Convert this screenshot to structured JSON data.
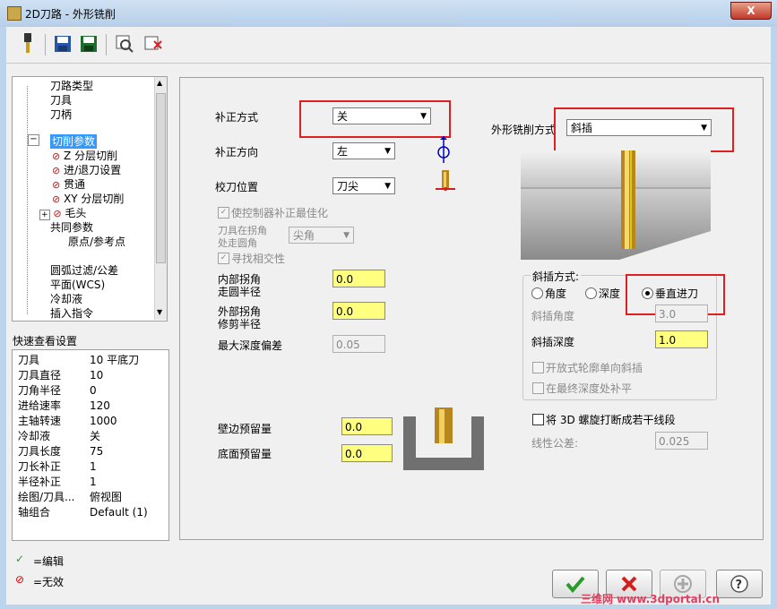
{
  "window": {
    "title": "2D刀路 - 外形铣削",
    "close_label": "X"
  },
  "toolbar": {
    "icons": [
      "tool-icon",
      "save-icon",
      "save-all-icon",
      "preview-icon",
      "delete-icon"
    ]
  },
  "tree": {
    "items": [
      {
        "label": "刀路类型"
      },
      {
        "label": "刀具"
      },
      {
        "label": "刀柄"
      },
      {
        "label": "切削参数"
      },
      {
        "label": "Z 分层切削"
      },
      {
        "label": "进/退刀设置"
      },
      {
        "label": "贯通"
      },
      {
        "label": "XY 分层切削"
      },
      {
        "label": "毛头"
      },
      {
        "label": "共同参数"
      },
      {
        "label": "原点/参考点"
      },
      {
        "label": "圆弧过滤/公差"
      },
      {
        "label": "平面(WCS)"
      },
      {
        "label": "冷却液"
      },
      {
        "label": "插入指令"
      }
    ]
  },
  "quickview": {
    "title": "快速查看设置",
    "rows": [
      {
        "key": "刀具",
        "value": "10 平底刀"
      },
      {
        "key": "刀具直径",
        "value": "10"
      },
      {
        "key": "刀角半径",
        "value": "0"
      },
      {
        "key": "进给速率",
        "value": "120"
      },
      {
        "key": "主轴转速",
        "value": "1000"
      },
      {
        "key": "冷却液",
        "value": "关"
      },
      {
        "key": "刀具长度",
        "value": "75"
      },
      {
        "key": "刀长补正",
        "value": "1"
      },
      {
        "key": "半径补正",
        "value": "1"
      },
      {
        "key": "绘图/刀具...",
        "value": "俯视图"
      },
      {
        "key": "轴组合",
        "value": "Default (1)"
      }
    ]
  },
  "legend": {
    "edit": "=编辑",
    "invalid": "=无效"
  },
  "params": {
    "comp_type_label": "补正方式",
    "comp_type_value": "关",
    "comp_dir_label": "补正方向",
    "comp_dir_value": "左",
    "tip_label": "校刀位置",
    "tip_value": "刀尖",
    "optimize_label": "使控制器补正最佳化",
    "corner_label_1": "刀具在拐角",
    "corner_label_2": "处走圆角",
    "corner_value": "尖角",
    "tangency_label": "寻找相交性",
    "inner_label_1": "内部拐角",
    "inner_label_2": "走圆半径",
    "inner_value": "0.0",
    "outer_label_1": "外部拐角",
    "outer_label_2": "修剪半径",
    "outer_value": "0.0",
    "maxdev_label": "最大深度偏差",
    "maxdev_value": "0.05",
    "wall_label": "壁边预留量",
    "wall_value": "0.0",
    "floor_label": "底面预留量",
    "floor_value": "0.0",
    "contour_type_label": "外形铣削方式",
    "contour_type_value": "斜插",
    "ramp_group_label": "斜插方式:",
    "ramp_angle_opt": "角度",
    "ramp_depth_opt": "深度",
    "ramp_vertical_opt": "垂直进刀",
    "ramp_angle_label": "斜插角度",
    "ramp_angle_value": "3.0",
    "ramp_depth_label": "斜插深度",
    "ramp_depth_value": "1.0",
    "open_contour_label": "开放式轮廓单向斜插",
    "final_depth_label": "在最终深度处补平",
    "helix_label": "将 3D 螺旋打断成若干线段",
    "linear_tol_label": "线性公差:",
    "linear_tol_value": "0.025"
  },
  "watermark": "三维网 www.3dportal.cn"
}
